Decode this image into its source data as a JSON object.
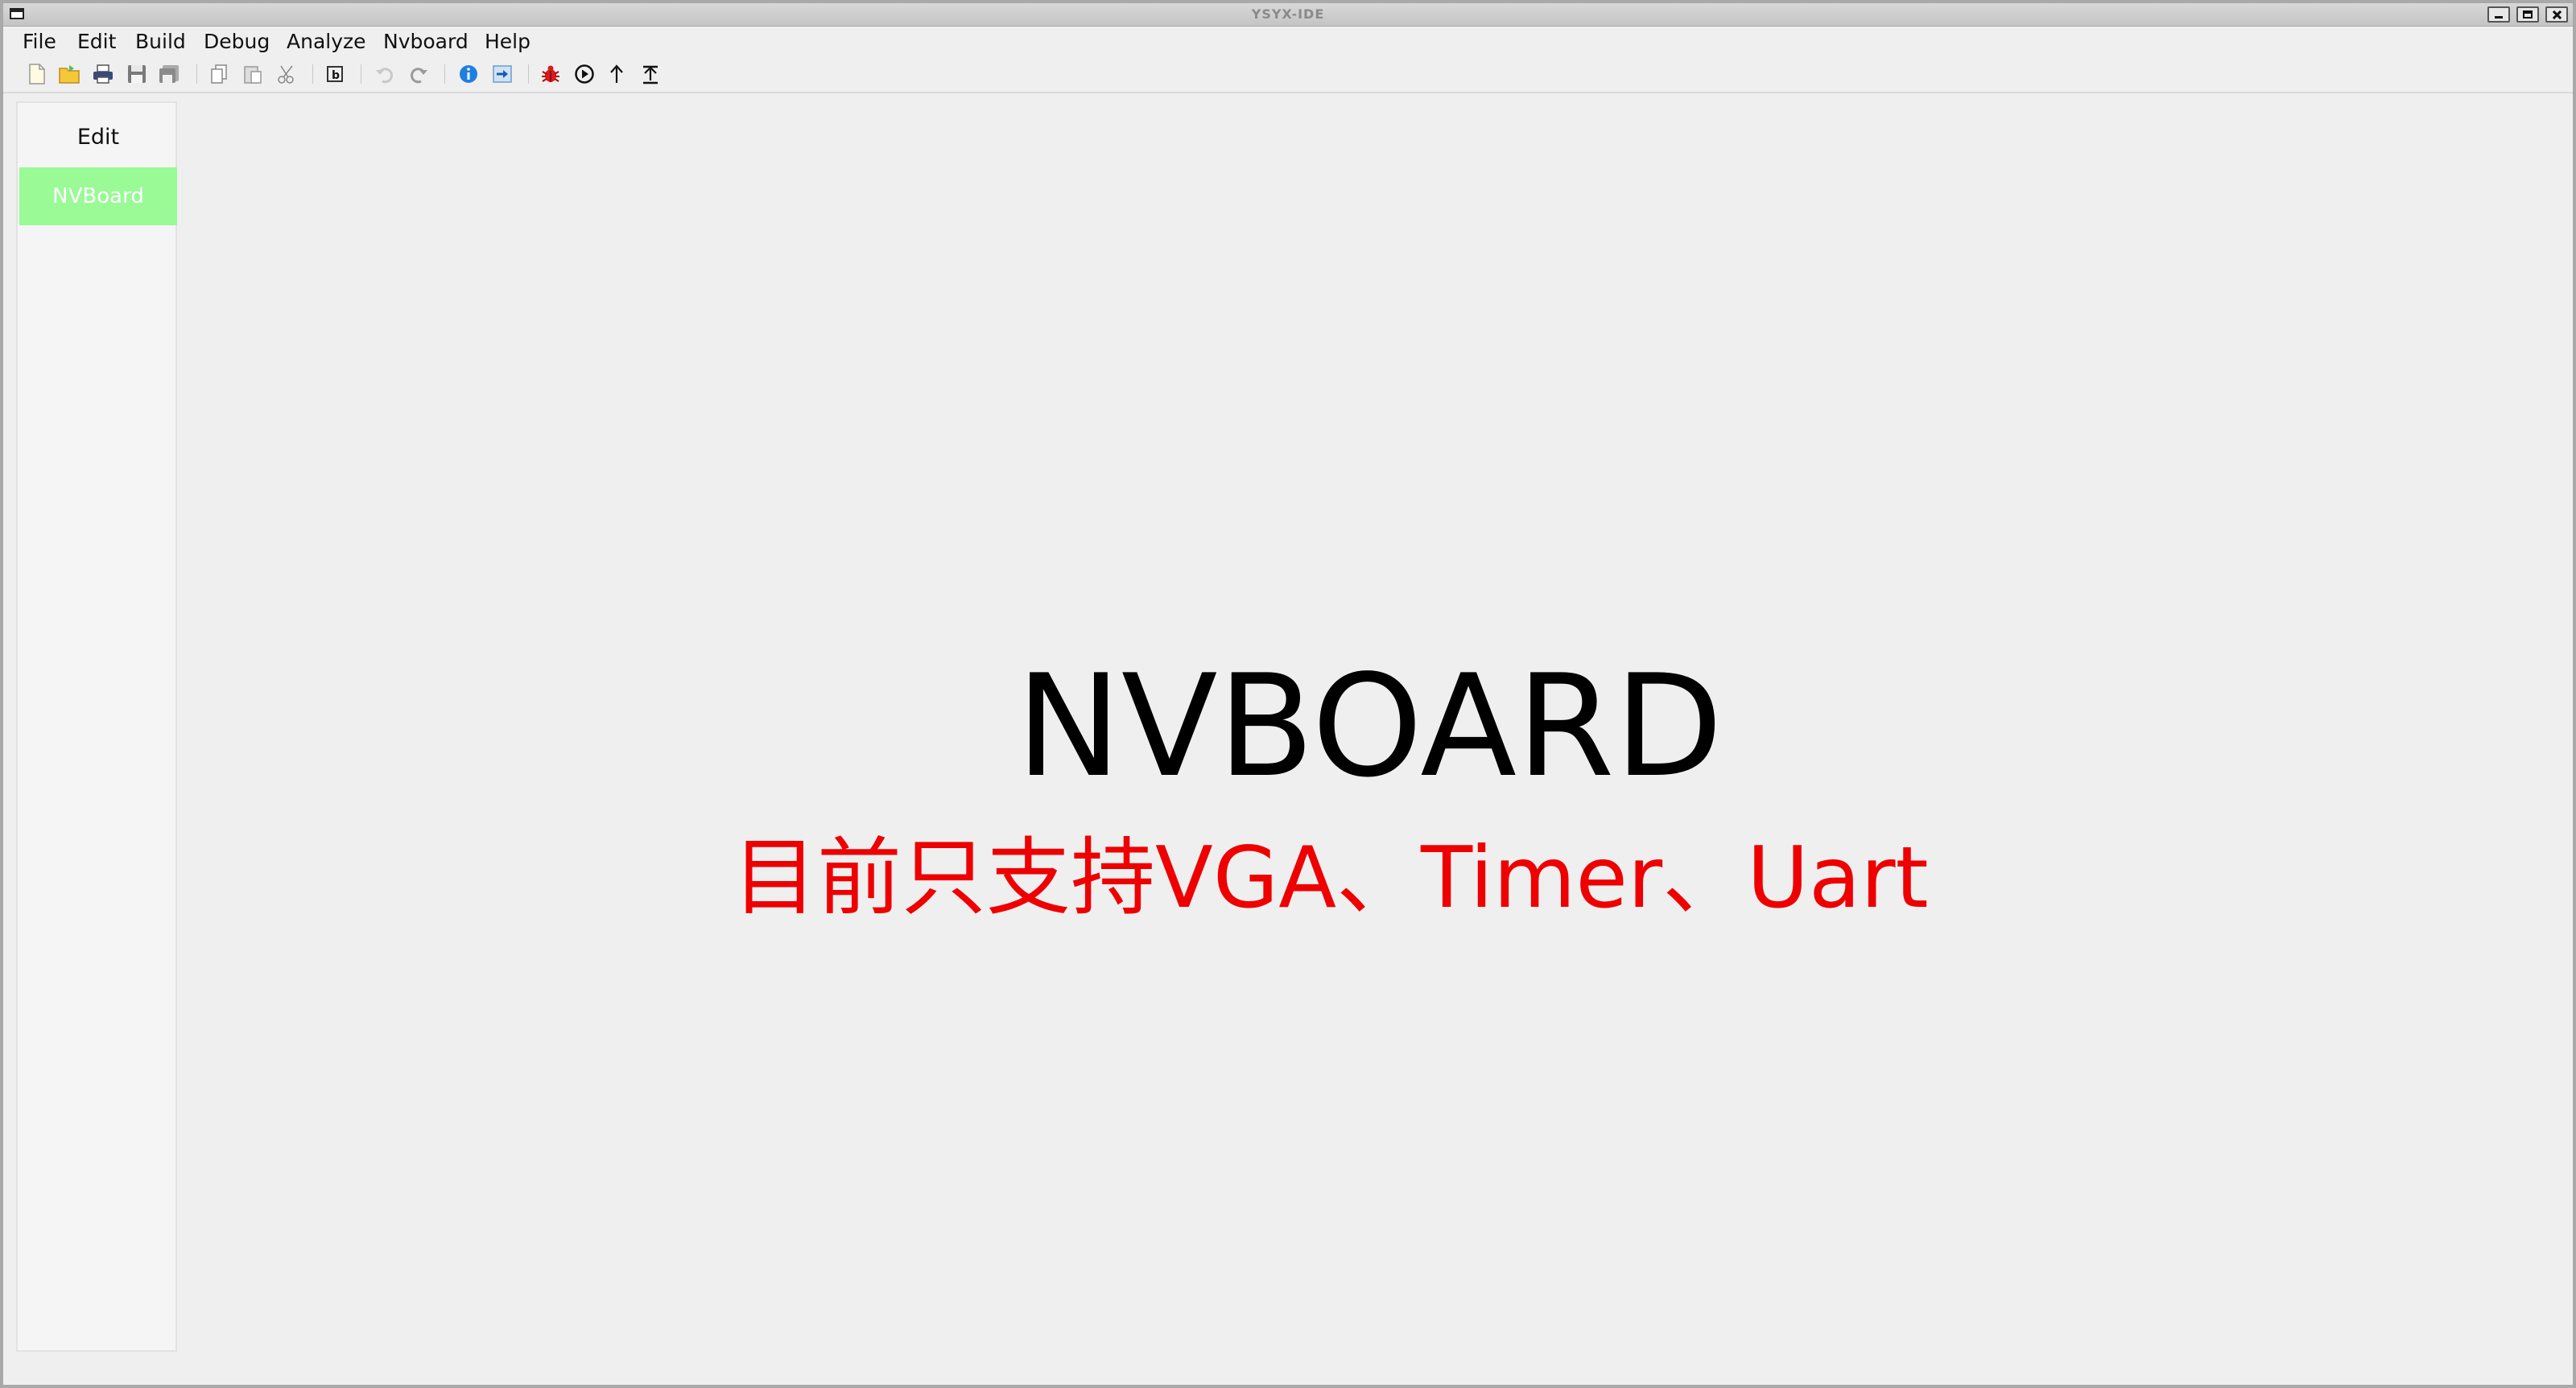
{
  "window": {
    "title": "YSYX-IDE"
  },
  "menubar": {
    "items": [
      "File",
      "Edit",
      "Build",
      "Debug",
      "Analyze",
      "Nvboard",
      "Help"
    ]
  },
  "toolbar": {
    "icons": [
      "new-file-icon",
      "open-folder-icon",
      "print-icon",
      "save-icon",
      "save-all-icon",
      "copy-icon",
      "paste-icon",
      "cut-icon",
      "build-icon",
      "undo-icon",
      "redo-icon",
      "info-icon",
      "run-arrow-icon",
      "debug-bug-icon",
      "play-circle-icon",
      "step-up-icon",
      "upload-icon"
    ]
  },
  "sidebar": {
    "items": [
      {
        "label": "Edit",
        "active": false
      },
      {
        "label": "NVBoard",
        "active": true
      }
    ],
    "active_color": "#99fa96"
  },
  "main": {
    "title": "NVBOARD",
    "subtitle": "目前只支持VGA、Timer、Uart",
    "subtitle_color": "#ee0000"
  }
}
